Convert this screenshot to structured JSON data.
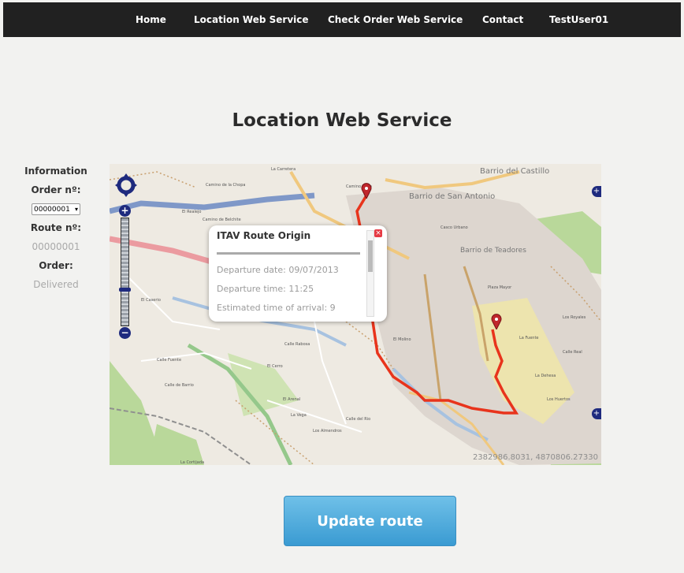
{
  "nav": {
    "items": [
      {
        "label": "Home"
      },
      {
        "label": "Location Web Service"
      },
      {
        "label": "Check Order Web Service"
      },
      {
        "label": "Contact"
      },
      {
        "label": "TestUser01"
      }
    ]
  },
  "page": {
    "title": "Location Web Service",
    "update_button_label": "Update route"
  },
  "info": {
    "heading": "Information",
    "order_label": "Order nº:",
    "order_selected": "00000001",
    "route_label": "Route nº:",
    "route_value": "00000001",
    "status_label": "Order:",
    "status_value": "Delivered"
  },
  "map": {
    "place_labels": [
      "Barrio del Castillo",
      "Barrio de San Antonio",
      "Barrio de Teadores",
      "Los Royales",
      "La Carretera",
      "Camino de la Chopa",
      "El Realejo",
      "Camino de Belchite",
      "El Caserio",
      "Calle Fuente",
      "Calle de Barrio",
      "Calle Rabosa",
      "El Arenal",
      "La Vega",
      "Los Almendros",
      "Calle del Rio",
      "La Cortijada",
      "El Cerro",
      "La Fuente",
      "La Dehesa",
      "Calle Real",
      "Plaza Mayor",
      "Casco Urbano",
      "Los Huertos",
      "Camino Viejo",
      "El Molino"
    ],
    "coordinates": "2382986.8031, 4870806.27330",
    "popup": {
      "title": "ITAV Route Origin",
      "departure_date": "Departure date: 09/07/2013",
      "departure_time": "Departure time: 11:25",
      "eta": "Estimated time of arrival: 9",
      "close_symbol": "×"
    },
    "zoom_in_symbol": "+",
    "zoom_out_symbol": "−",
    "layer_symbol": "+"
  },
  "colors": {
    "navbar": "#212121",
    "route": "#e8341c",
    "button": "#4aa8dc",
    "map_control": "#1e2a7e"
  }
}
